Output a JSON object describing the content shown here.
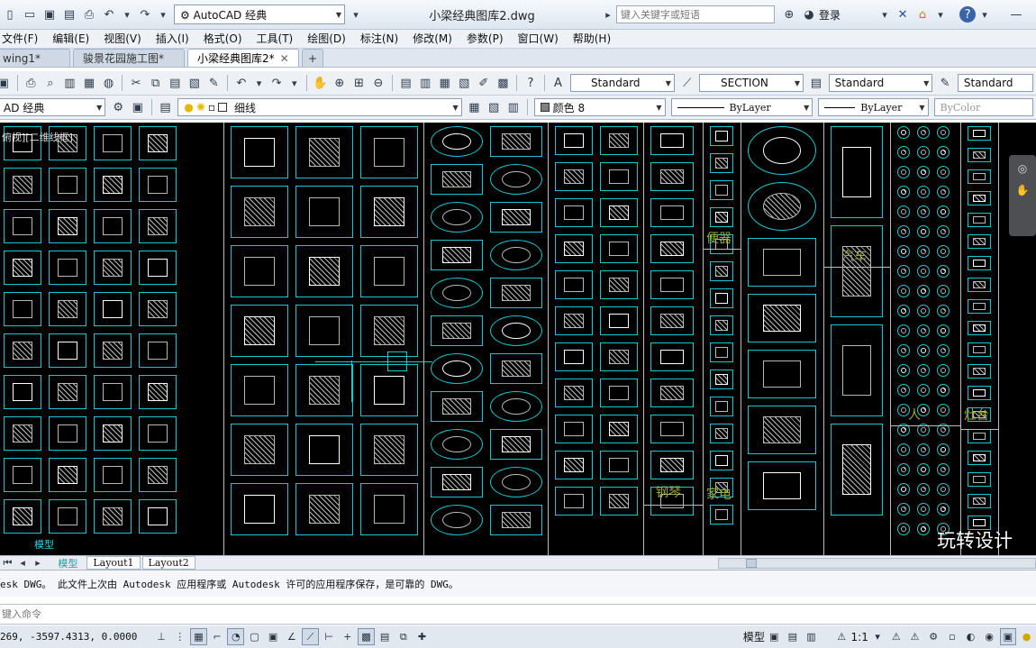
{
  "titlebar": {
    "workspace": "AutoCAD 经典",
    "document_title": "小梁经典图库2.dwg",
    "search_placeholder": "键入关键字或短语",
    "login": "登录"
  },
  "menu": [
    "文件(F)",
    "编辑(E)",
    "视图(V)",
    "插入(I)",
    "格式(O)",
    "工具(T)",
    "绘图(D)",
    "标注(N)",
    "修改(M)",
    "参数(P)",
    "窗口(W)",
    "帮助(H)"
  ],
  "tabs": [
    {
      "label": "wing1*",
      "active": false
    },
    {
      "label": "骏景花园施工图*",
      "active": false
    },
    {
      "label": "小梁经典图库2*",
      "active": true
    }
  ],
  "toolbar1": {
    "text_style": "Standard",
    "dim_style": "SECTION",
    "table_style": "Standard",
    "mleader_style": "Standard"
  },
  "toolbar2": {
    "workspace": "AD 经典",
    "layer": "细线",
    "color": "颜色 8",
    "linetype": "ByLayer",
    "lineweight": "ByLayer",
    "plotstyle": "ByColor"
  },
  "viewport": {
    "view_label": "俯视][二维线框]"
  },
  "columns": [
    {
      "label": "便器"
    },
    {
      "label": "汽车"
    },
    {
      "label": "钢琴"
    },
    {
      "label": "家电"
    },
    {
      "label": "人"
    },
    {
      "label": "灶台"
    },
    {
      "label": "玩转设计"
    }
  ],
  "layout_tabs": [
    "模型",
    "Layout1",
    "Layout2"
  ],
  "command": {
    "history": "esk DWG。   此文件上次由 Autodesk 应用程序或 Autodesk 许可的应用程序保存，是可靠的 DWG。",
    "prompt": "键入命令"
  },
  "statusbar": {
    "coords": "269, -3597.4313, 0.0000",
    "model": "模型",
    "scale": "1:1"
  },
  "colors": {
    "cyan": "#18c8d0",
    "white": "#ffffff",
    "gray": "#b8b8b8",
    "label": "#9aa83a"
  }
}
